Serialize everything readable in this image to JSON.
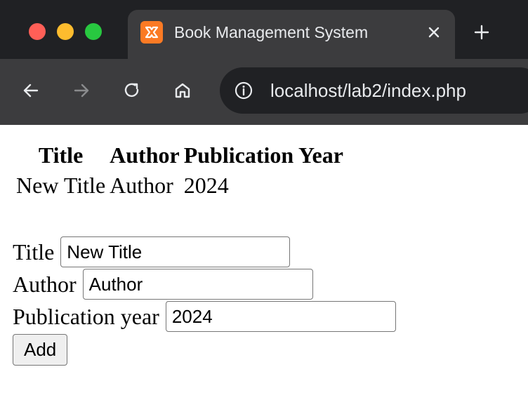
{
  "browser": {
    "tab_title": "Book Management System",
    "url": "localhost/lab2/index.php",
    "colors": {
      "close_dot": "#ff5f57",
      "minimize_dot": "#febc2e",
      "zoom_dot": "#28c840",
      "tab_favicon": "#fb7a24"
    },
    "icons": [
      "back-arrow-icon",
      "forward-arrow-icon",
      "reload-icon",
      "home-icon",
      "info-icon",
      "close-icon",
      "plus-icon"
    ]
  },
  "table": {
    "headers": [
      "Title",
      "Author",
      "Publication Year"
    ],
    "rows": [
      [
        "New Title",
        "Author",
        "2024"
      ]
    ]
  },
  "form": {
    "title_label": "Title",
    "title_value": "New Title",
    "author_label": "Author",
    "author_value": "Author",
    "year_label": "Publication year",
    "year_value": "2024",
    "submit_label": "Add"
  }
}
